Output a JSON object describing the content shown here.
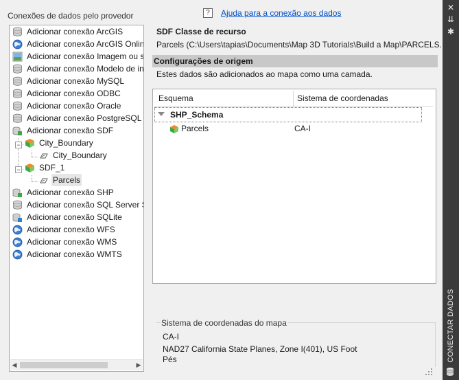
{
  "left_panel": {
    "title": "Conexões de dados pelo provedor",
    "items": [
      {
        "label": "Adicionar conexão ArcGIS",
        "icon": "database-icon",
        "indent": 0
      },
      {
        "label": "Adicionar conexão ArcGIS Online",
        "icon": "globe-icon",
        "indent": 0
      },
      {
        "label": "Adicionar conexão Imagem ou superfície",
        "icon": "raster-icon",
        "indent": 0
      },
      {
        "label": "Adicionar conexão Modelo de informações",
        "icon": "database-icon",
        "indent": 0
      },
      {
        "label": "Adicionar conexão MySQL",
        "icon": "database-icon",
        "indent": 0
      },
      {
        "label": "Adicionar conexão ODBC",
        "icon": "database-icon",
        "indent": 0
      },
      {
        "label": "Adicionar conexão Oracle",
        "icon": "database-icon",
        "indent": 0
      },
      {
        "label": "Adicionar conexão PostgreSQL",
        "icon": "database-icon",
        "indent": 0
      },
      {
        "label": "Adicionar conexão SDF",
        "icon": "sdf-icon",
        "indent": 0
      },
      {
        "label": "City_Boundary",
        "icon": "cube-icon",
        "indent": 1
      },
      {
        "label": "City_Boundary",
        "icon": "feature-class-icon",
        "indent": 2
      },
      {
        "label": "SDF_1",
        "icon": "cube-icon",
        "indent": 1
      },
      {
        "label": "Parcels",
        "icon": "feature-class-icon",
        "indent": 2
      },
      {
        "label": "Adicionar conexão SHP",
        "icon": "shp-icon",
        "indent": 0
      },
      {
        "label": "Adicionar conexão SQL Server Spatial",
        "icon": "database-icon",
        "indent": 0
      },
      {
        "label": "Adicionar conexão SQLite",
        "icon": "sqlite-icon",
        "indent": 0
      },
      {
        "label": "Adicionar conexão WFS",
        "icon": "globe-icon",
        "indent": 0
      },
      {
        "label": "Adicionar conexão WMS",
        "icon": "globe-icon",
        "indent": 0
      },
      {
        "label": "Adicionar conexão WMTS",
        "icon": "globe-icon",
        "indent": 0
      }
    ],
    "selected_index": 12
  },
  "help": {
    "icon": "help-icon",
    "link": "Ajuda para a conexão aos dados"
  },
  "resource": {
    "title": "SDF Classe de recurso",
    "path": "Parcels (C:\\Users\\tapias\\Documents\\Map 3D Tutorials\\Build a Map\\PARCELS."
  },
  "source_settings": {
    "title": "Configurações de origem",
    "description": "Estes dados são adicionados ao mapa como uma camada."
  },
  "grid": {
    "columns": [
      "Esquema",
      "Sistema de coordenadas"
    ],
    "schema": "SHP_Schema",
    "rows": [
      {
        "name": "Parcels",
        "crs": "CA-I"
      }
    ]
  },
  "map_crs": {
    "title": "Sistema de coordenadas do mapa",
    "code": "CA-I",
    "description": "NAD27 California State Planes, Zone I(401), US Foot",
    "unit": "Pés"
  },
  "side_bar": {
    "title": "CONECTAR DADOS"
  }
}
